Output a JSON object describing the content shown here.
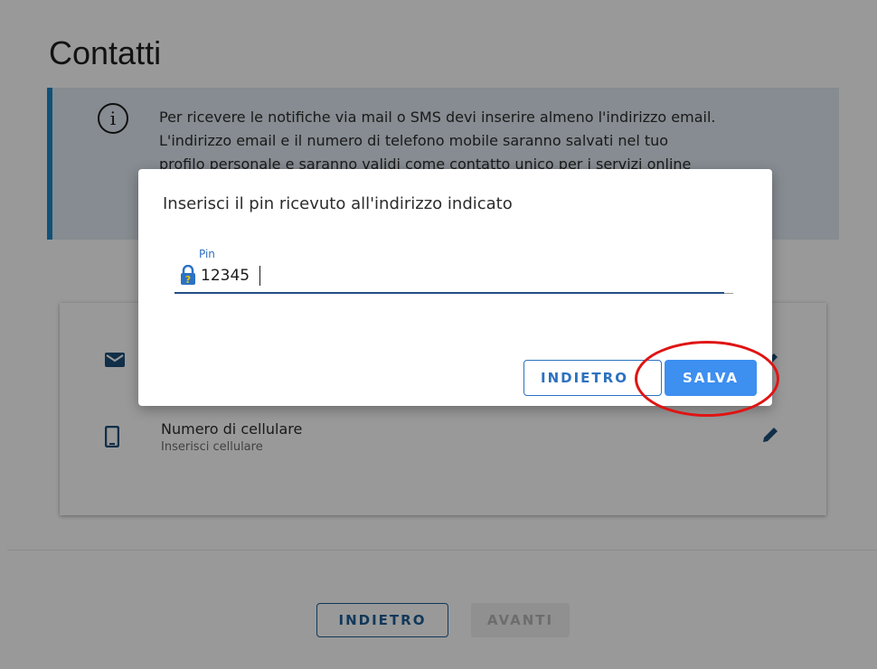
{
  "page": {
    "title": "Contatti",
    "info": {
      "icon": "info-icon",
      "lines": [
        "Per ricevere le notifiche via mail o SMS devi inserire almeno l'indirizzo email.",
        "L'indirizzo email e il numero di telefono mobile saranno salvati nel tuo",
        "profilo personale e saranno validi come contatto unico per i servizi online"
      ]
    },
    "contacts": [
      {
        "icon": "mail-icon",
        "label": "",
        "sub": ""
      },
      {
        "icon": "phone-icon",
        "label": "Numero di cellulare",
        "sub": "Inserisci cellulare"
      }
    ],
    "footer": {
      "back_label": "INDIETRO",
      "next_label": "AVANTI"
    }
  },
  "modal": {
    "title": "Inserisci il pin ricevuto all'indirizzo indicato",
    "field": {
      "label": "Pin",
      "value": "12345",
      "icon": "lock-question-icon"
    },
    "back_label": "INDIETRO",
    "save_label": "SALVA"
  },
  "colors": {
    "accent": "#1b87c9",
    "primary_button": "#3d8ff0",
    "outline_button": "#2c71c0",
    "highlight": "#e01414"
  }
}
